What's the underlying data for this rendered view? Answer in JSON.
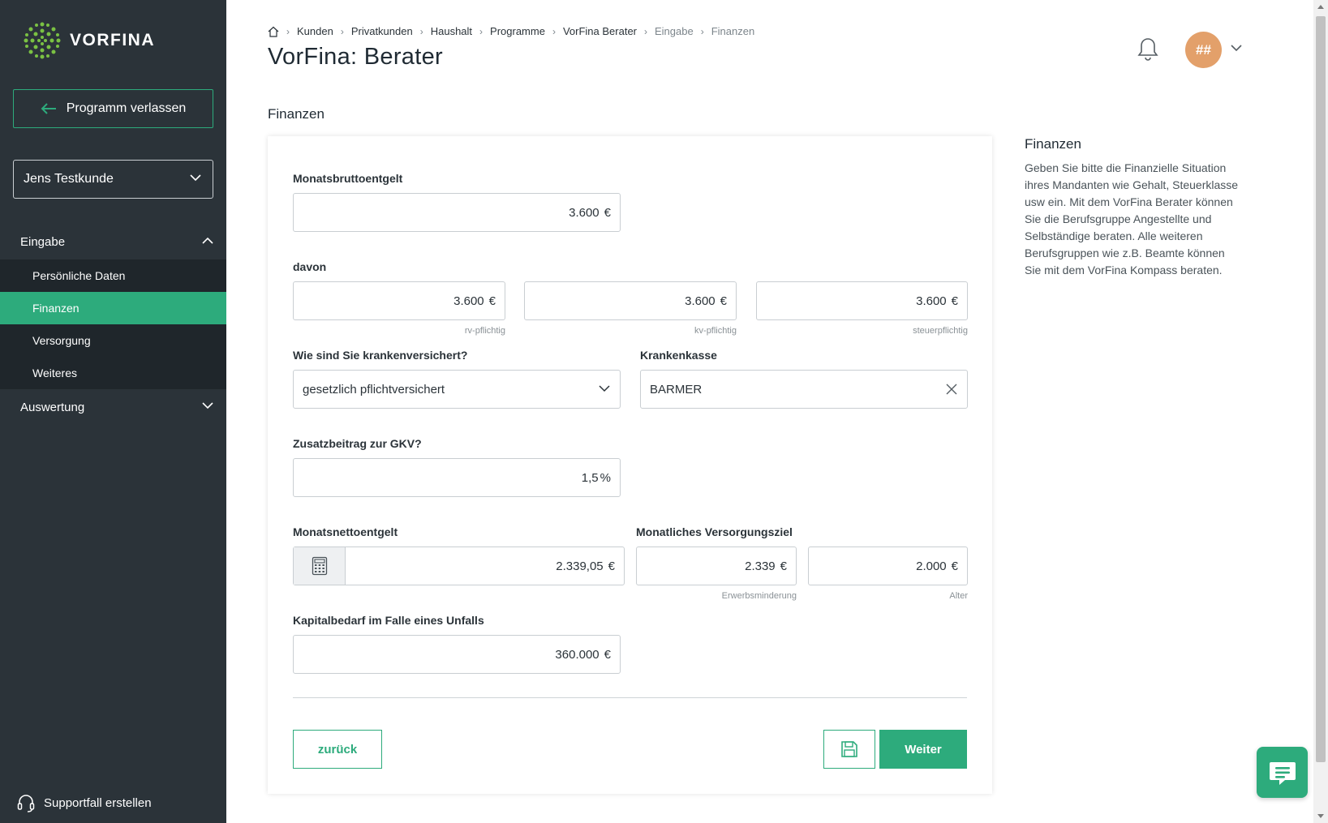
{
  "brand": {
    "name": "VORFINA",
    "accent": "#2dab7c",
    "sidebar_bg": "#2b3339"
  },
  "sidebar": {
    "leave_label": "Programm verlassen",
    "client": "Jens Testkunde",
    "sections": [
      {
        "label": "Eingabe",
        "expanded": true,
        "items": [
          "Persönliche Daten",
          "Finanzen",
          "Versorgung",
          "Weiteres"
        ],
        "active": "Finanzen"
      },
      {
        "label": "Auswertung",
        "expanded": false
      }
    ],
    "support_label": "Supportfall erstellen"
  },
  "header": {
    "breadcrumb": [
      "Kunden",
      "Privatkunden",
      "Haushalt",
      "Programme",
      "VorFina Berater",
      "Eingabe",
      "Finanzen"
    ],
    "title": "VorFina: Berater",
    "avatar_initials": "##"
  },
  "form": {
    "section_title": "Finanzen",
    "brutto": {
      "label": "Monatsbruttoentgelt",
      "value": "3.600",
      "unit": "€"
    },
    "davon": {
      "label": "davon",
      "fields": [
        {
          "value": "3.600",
          "unit": "€",
          "hint": "rv-pflichtig"
        },
        {
          "value": "3.600",
          "unit": "€",
          "hint": "kv-pflichtig"
        },
        {
          "value": "3.600",
          "unit": "€",
          "hint": "steuerpflichtig"
        }
      ]
    },
    "versicherung": {
      "label": "Wie sind Sie krankenversichert?",
      "value": "gesetzlich pflichtversichert"
    },
    "krankenkasse": {
      "label": "Krankenkasse",
      "value": "BARMER"
    },
    "zusatzbeitrag": {
      "label": "Zusatzbeitrag zur GKV?",
      "value": "1,5",
      "unit": "%"
    },
    "netto": {
      "label": "Monatsnettoentgelt",
      "value": "2.339,05",
      "unit": "€"
    },
    "versorgungsziel": {
      "label": "Monatliches Versorgungsziel",
      "fields": [
        {
          "value": "2.339",
          "unit": "€",
          "hint": "Erwerbsminderung"
        },
        {
          "value": "2.000",
          "unit": "€",
          "hint": "Alter"
        }
      ]
    },
    "unfall": {
      "label": "Kapitalbedarf im Falle eines Unfalls",
      "value": "360.000",
      "unit": "€"
    },
    "buttons": {
      "back": "zurück",
      "next": "Weiter"
    }
  },
  "help": {
    "title": "Finanzen",
    "text": "Geben Sie bitte die Finanzielle Situation ihres Mandanten wie Gehalt, Steuerklasse usw ein. Mit dem VorFina Berater können Sie die Berufsgruppe Angestellte und Selbständige beraten. Alle weiteren Berufsgruppen wie z.B. Beamte können Sie mit dem VorFina Kompass beraten."
  }
}
